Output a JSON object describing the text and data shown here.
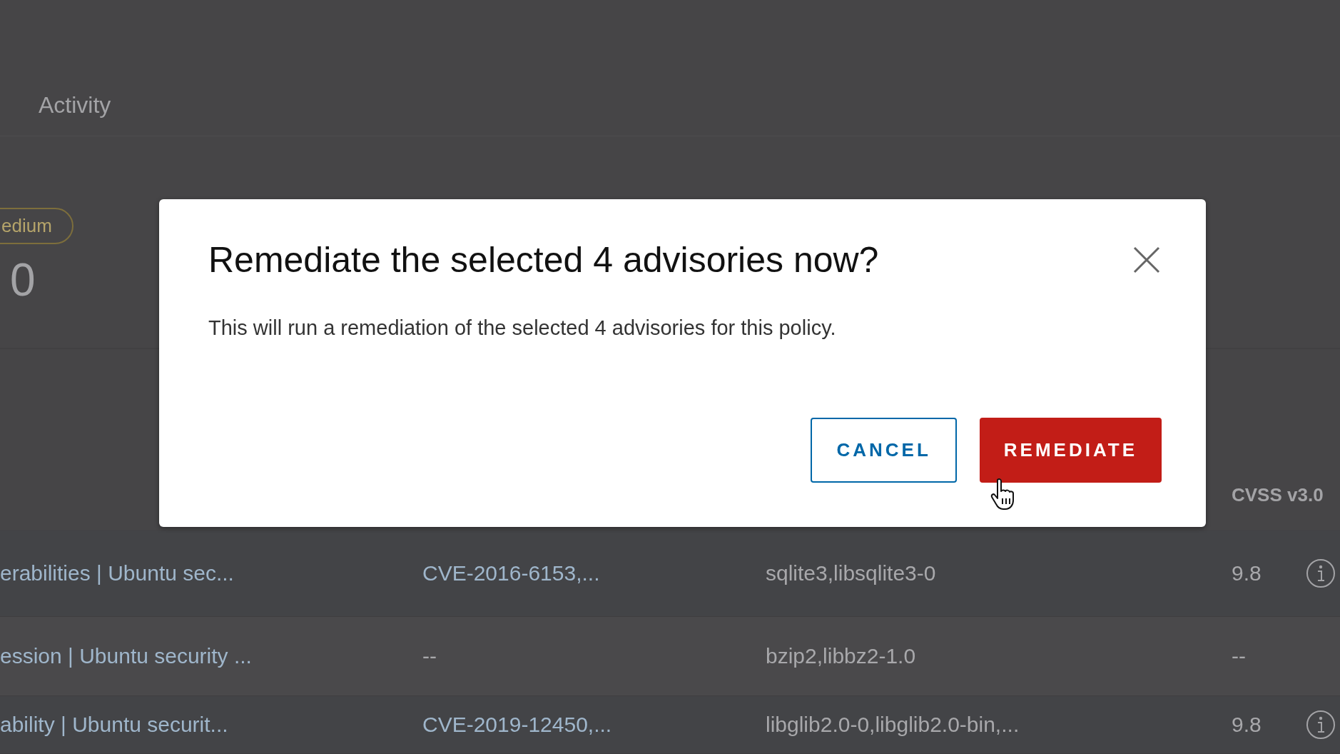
{
  "background": {
    "tab": "Activity",
    "badge": "edium",
    "count": "0",
    "table": {
      "header": "CVSS v3.0",
      "rows": [
        {
          "title": "erabilities | Ubuntu sec...",
          "cves": "CVE-2016-6153,...",
          "packages": "sqlite3,libsqlite3-0",
          "score": "9.8",
          "info": true
        },
        {
          "title": "ession | Ubuntu security ...",
          "cves": "--",
          "packages": "bzip2,libbz2-1.0",
          "score": "--",
          "info": false
        },
        {
          "title": "ability | Ubuntu securit...",
          "cves": "CVE-2019-12450,...",
          "packages": "libglib2.0-0,libglib2.0-bin,...",
          "score": "9.8",
          "info": true
        }
      ]
    }
  },
  "dialog": {
    "title": "Remediate the selected 4 advisories now?",
    "message": "This will run a remediation of the selected 4 advisories for this policy.",
    "buttons": [
      {
        "label": "CANCEL",
        "kind": "outline"
      },
      {
        "label": "REMEDIATE",
        "kind": "danger"
      }
    ]
  }
}
